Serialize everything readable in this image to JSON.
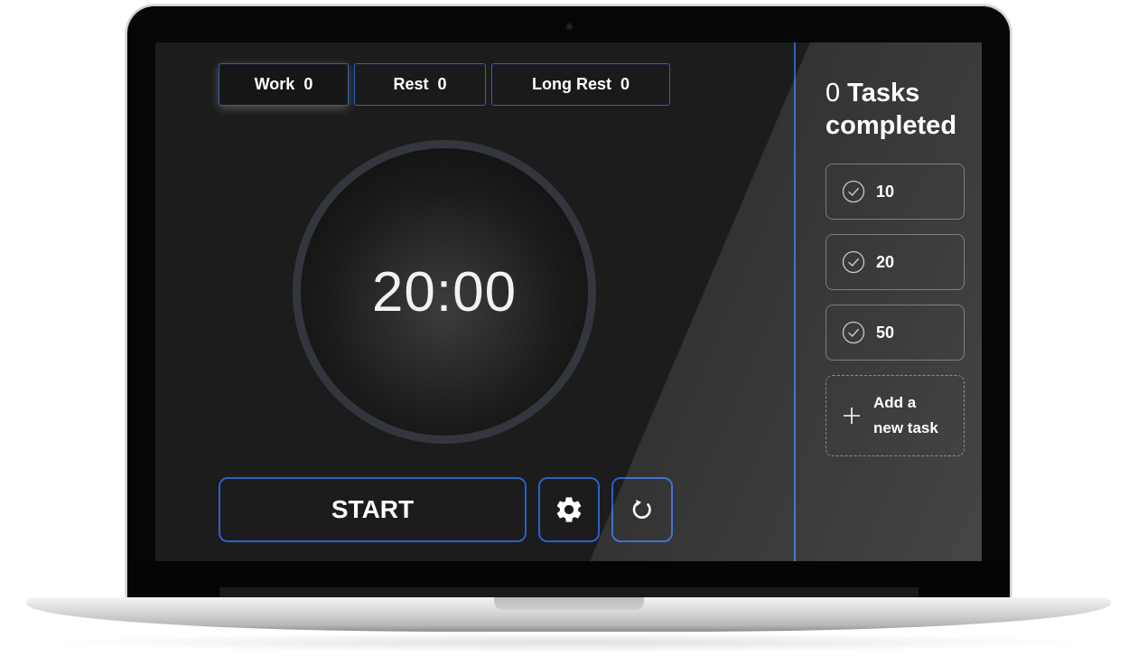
{
  "modes": {
    "work": {
      "label": "Work",
      "count": "0"
    },
    "rest": {
      "label": "Rest",
      "count": "0"
    },
    "long_rest": {
      "label": "Long Rest",
      "count": "0"
    },
    "active": "work"
  },
  "timer": {
    "display": "20:00"
  },
  "controls": {
    "start_label": "START",
    "settings_icon": "gear-icon",
    "reset_icon": "reset-icon"
  },
  "tasks": {
    "completed_count": "0",
    "completed_label": "Tasks completed",
    "items": [
      {
        "label": "10",
        "icon": "check-circle-icon"
      },
      {
        "label": "20",
        "icon": "check-circle-icon"
      },
      {
        "label": "50",
        "icon": "check-circle-icon"
      }
    ],
    "add_line1": "Add a",
    "add_line2": "new task",
    "add_icon": "plus-icon"
  },
  "colors": {
    "accent": "#2c5fc9",
    "background": "#1c1c1c",
    "text": "#ffffff"
  }
}
